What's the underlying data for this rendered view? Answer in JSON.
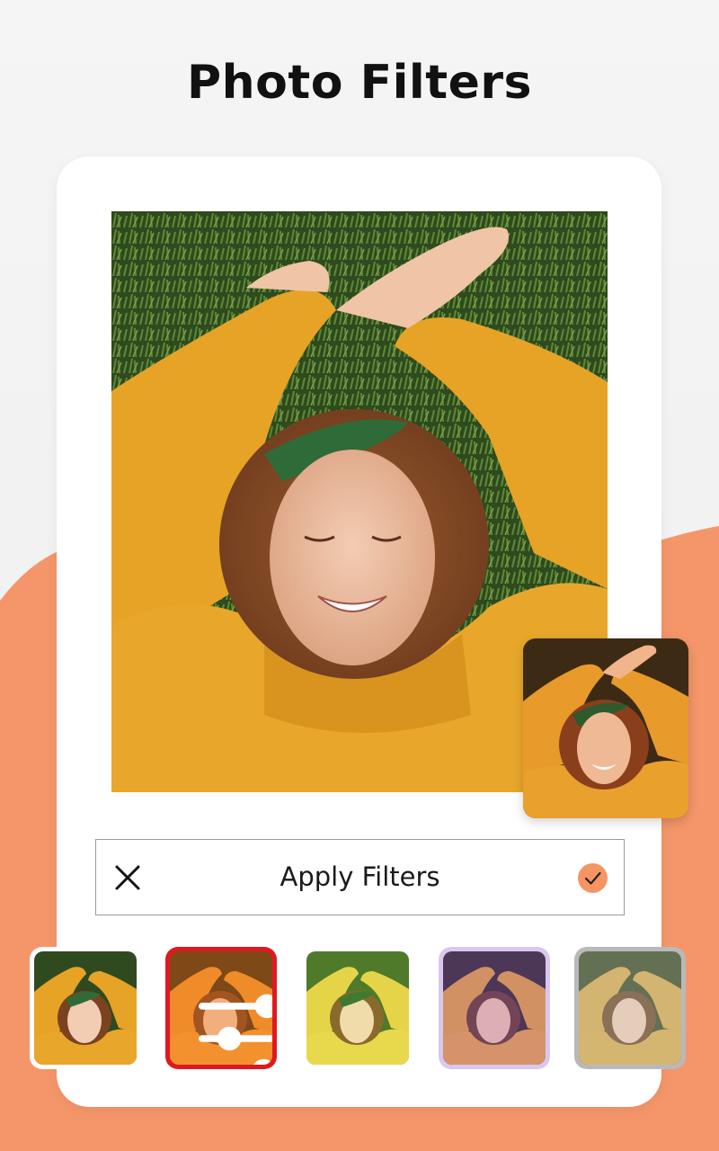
{
  "title": "Photo Filters",
  "colors": {
    "accent": "#f59564",
    "background_orange": "#f5966a",
    "selected_border": "#e0191f",
    "text": "#111111"
  },
  "main_photo": {
    "icon": "portrait-photo"
  },
  "preview": {
    "icon": "filtered-preview-photo"
  },
  "action_bar": {
    "label": "Apply Filters",
    "close_icon": "close-icon",
    "confirm_icon": "check-icon"
  },
  "filters": [
    {
      "name": "original",
      "border": "#ffffff",
      "tint": "none"
    },
    {
      "name": "adjust",
      "border": "#e0191f",
      "tint": "warm-orange",
      "selected": true,
      "overlay_icon": "sliders-icon"
    },
    {
      "name": "yellow-green",
      "border": "#ffffff",
      "tint": "yellow"
    },
    {
      "name": "lavender",
      "border": "#d8c8f0",
      "tint": "purple"
    },
    {
      "name": "faded",
      "border": "#b9b9b9",
      "tint": "faded"
    }
  ]
}
